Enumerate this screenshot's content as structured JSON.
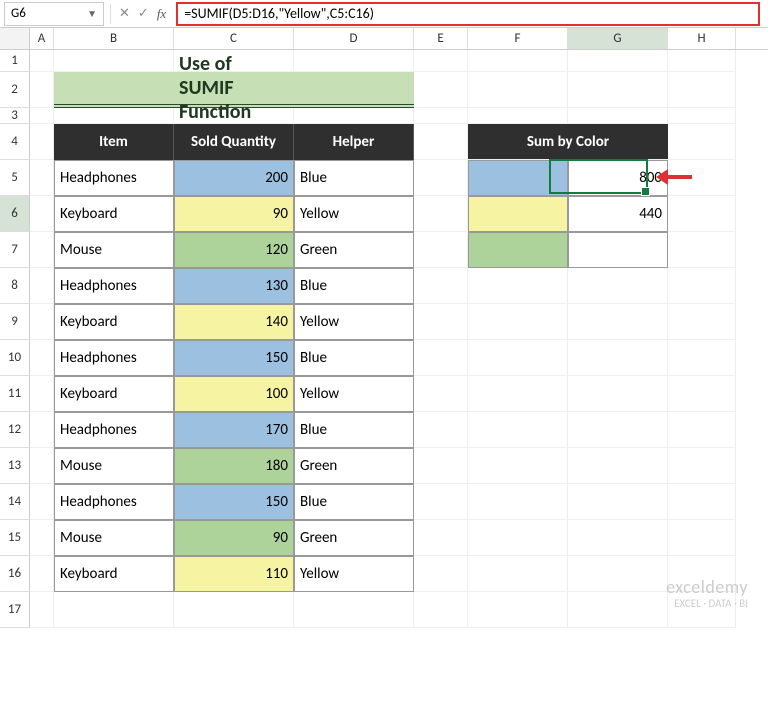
{
  "nameBox": "G6",
  "formula": "=SUMIF(D5:D16,\"Yellow\",C5:C16)",
  "columns": [
    "A",
    "B",
    "C",
    "D",
    "E",
    "F",
    "G",
    "H"
  ],
  "rowNums": [
    "1",
    "2",
    "3",
    "4",
    "5",
    "6",
    "7",
    "8",
    "9",
    "10",
    "11",
    "12",
    "13",
    "14",
    "15",
    "16",
    "17"
  ],
  "title": "Use of SUMIF Function",
  "headers": {
    "item": "Item",
    "qty": "Sold Quantity",
    "helper": "Helper"
  },
  "data": [
    {
      "item": "Headphones",
      "qty": "200",
      "helper": "Blue",
      "color": "blue"
    },
    {
      "item": "Keyboard",
      "qty": "90",
      "helper": "Yellow",
      "color": "yellow"
    },
    {
      "item": "Mouse",
      "qty": "120",
      "helper": "Green",
      "color": "green"
    },
    {
      "item": "Headphones",
      "qty": "130",
      "helper": "Blue",
      "color": "blue"
    },
    {
      "item": "Keyboard",
      "qty": "140",
      "helper": "Yellow",
      "color": "yellow"
    },
    {
      "item": "Headphones",
      "qty": "150",
      "helper": "Blue",
      "color": "blue"
    },
    {
      "item": "Keyboard",
      "qty": "100",
      "helper": "Yellow",
      "color": "yellow"
    },
    {
      "item": "Headphones",
      "qty": "170",
      "helper": "Blue",
      "color": "blue"
    },
    {
      "item": "Mouse",
      "qty": "180",
      "helper": "Green",
      "color": "green"
    },
    {
      "item": "Headphones",
      "qty": "150",
      "helper": "Blue",
      "color": "blue"
    },
    {
      "item": "Mouse",
      "qty": "90",
      "helper": "Green",
      "color": "green"
    },
    {
      "item": "Keyboard",
      "qty": "110",
      "helper": "Yellow",
      "color": "yellow"
    }
  ],
  "sideHeader": "Sum by Color",
  "side": [
    {
      "color": "blue",
      "value": "800"
    },
    {
      "color": "yellow",
      "value": "440"
    },
    {
      "color": "green",
      "value": ""
    }
  ],
  "watermark": {
    "brand": "exceldemy",
    "tag": "EXCEL · DATA · BI"
  },
  "activeCol": "G",
  "activeRow": "6"
}
